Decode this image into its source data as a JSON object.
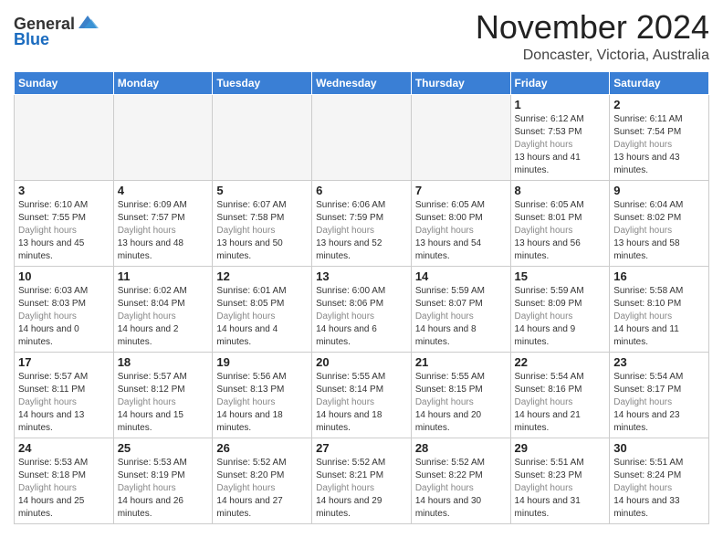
{
  "header": {
    "logo_line1": "General",
    "logo_line2": "Blue",
    "month": "November 2024",
    "location": "Doncaster, Victoria, Australia"
  },
  "weekdays": [
    "Sunday",
    "Monday",
    "Tuesday",
    "Wednesday",
    "Thursday",
    "Friday",
    "Saturday"
  ],
  "weeks": [
    [
      {
        "day": "",
        "sunrise": "",
        "sunset": "",
        "daylight": ""
      },
      {
        "day": "",
        "sunrise": "",
        "sunset": "",
        "daylight": ""
      },
      {
        "day": "",
        "sunrise": "",
        "sunset": "",
        "daylight": ""
      },
      {
        "day": "",
        "sunrise": "",
        "sunset": "",
        "daylight": ""
      },
      {
        "day": "",
        "sunrise": "",
        "sunset": "",
        "daylight": ""
      },
      {
        "day": "1",
        "sunrise": "Sunrise: 6:12 AM",
        "sunset": "Sunset: 7:53 PM",
        "daylight": "Daylight: 13 hours and 41 minutes."
      },
      {
        "day": "2",
        "sunrise": "Sunrise: 6:11 AM",
        "sunset": "Sunset: 7:54 PM",
        "daylight": "Daylight: 13 hours and 43 minutes."
      }
    ],
    [
      {
        "day": "3",
        "sunrise": "Sunrise: 6:10 AM",
        "sunset": "Sunset: 7:55 PM",
        "daylight": "Daylight: 13 hours and 45 minutes."
      },
      {
        "day": "4",
        "sunrise": "Sunrise: 6:09 AM",
        "sunset": "Sunset: 7:57 PM",
        "daylight": "Daylight: 13 hours and 48 minutes."
      },
      {
        "day": "5",
        "sunrise": "Sunrise: 6:07 AM",
        "sunset": "Sunset: 7:58 PM",
        "daylight": "Daylight: 13 hours and 50 minutes."
      },
      {
        "day": "6",
        "sunrise": "Sunrise: 6:06 AM",
        "sunset": "Sunset: 7:59 PM",
        "daylight": "Daylight: 13 hours and 52 minutes."
      },
      {
        "day": "7",
        "sunrise": "Sunrise: 6:05 AM",
        "sunset": "Sunset: 8:00 PM",
        "daylight": "Daylight: 13 hours and 54 minutes."
      },
      {
        "day": "8",
        "sunrise": "Sunrise: 6:05 AM",
        "sunset": "Sunset: 8:01 PM",
        "daylight": "Daylight: 13 hours and 56 minutes."
      },
      {
        "day": "9",
        "sunrise": "Sunrise: 6:04 AM",
        "sunset": "Sunset: 8:02 PM",
        "daylight": "Daylight: 13 hours and 58 minutes."
      }
    ],
    [
      {
        "day": "10",
        "sunrise": "Sunrise: 6:03 AM",
        "sunset": "Sunset: 8:03 PM",
        "daylight": "Daylight: 14 hours and 0 minutes."
      },
      {
        "day": "11",
        "sunrise": "Sunrise: 6:02 AM",
        "sunset": "Sunset: 8:04 PM",
        "daylight": "Daylight: 14 hours and 2 minutes."
      },
      {
        "day": "12",
        "sunrise": "Sunrise: 6:01 AM",
        "sunset": "Sunset: 8:05 PM",
        "daylight": "Daylight: 14 hours and 4 minutes."
      },
      {
        "day": "13",
        "sunrise": "Sunrise: 6:00 AM",
        "sunset": "Sunset: 8:06 PM",
        "daylight": "Daylight: 14 hours and 6 minutes."
      },
      {
        "day": "14",
        "sunrise": "Sunrise: 5:59 AM",
        "sunset": "Sunset: 8:07 PM",
        "daylight": "Daylight: 14 hours and 8 minutes."
      },
      {
        "day": "15",
        "sunrise": "Sunrise: 5:59 AM",
        "sunset": "Sunset: 8:09 PM",
        "daylight": "Daylight: 14 hours and 9 minutes."
      },
      {
        "day": "16",
        "sunrise": "Sunrise: 5:58 AM",
        "sunset": "Sunset: 8:10 PM",
        "daylight": "Daylight: 14 hours and 11 minutes."
      }
    ],
    [
      {
        "day": "17",
        "sunrise": "Sunrise: 5:57 AM",
        "sunset": "Sunset: 8:11 PM",
        "daylight": "Daylight: 14 hours and 13 minutes."
      },
      {
        "day": "18",
        "sunrise": "Sunrise: 5:57 AM",
        "sunset": "Sunset: 8:12 PM",
        "daylight": "Daylight: 14 hours and 15 minutes."
      },
      {
        "day": "19",
        "sunrise": "Sunrise: 5:56 AM",
        "sunset": "Sunset: 8:13 PM",
        "daylight": "Daylight: 14 hours and 18 minutes."
      },
      {
        "day": "20",
        "sunrise": "Sunrise: 5:55 AM",
        "sunset": "Sunset: 8:14 PM",
        "daylight": "Daylight: 14 hours and 18 minutes."
      },
      {
        "day": "21",
        "sunrise": "Sunrise: 5:55 AM",
        "sunset": "Sunset: 8:15 PM",
        "daylight": "Daylight: 14 hours and 20 minutes."
      },
      {
        "day": "22",
        "sunrise": "Sunrise: 5:54 AM",
        "sunset": "Sunset: 8:16 PM",
        "daylight": "Daylight: 14 hours and 21 minutes."
      },
      {
        "day": "23",
        "sunrise": "Sunrise: 5:54 AM",
        "sunset": "Sunset: 8:17 PM",
        "daylight": "Daylight: 14 hours and 23 minutes."
      }
    ],
    [
      {
        "day": "24",
        "sunrise": "Sunrise: 5:53 AM",
        "sunset": "Sunset: 8:18 PM",
        "daylight": "Daylight: 14 hours and 25 minutes."
      },
      {
        "day": "25",
        "sunrise": "Sunrise: 5:53 AM",
        "sunset": "Sunset: 8:19 PM",
        "daylight": "Daylight: 14 hours and 26 minutes."
      },
      {
        "day": "26",
        "sunrise": "Sunrise: 5:52 AM",
        "sunset": "Sunset: 8:20 PM",
        "daylight": "Daylight: 14 hours and 27 minutes."
      },
      {
        "day": "27",
        "sunrise": "Sunrise: 5:52 AM",
        "sunset": "Sunset: 8:21 PM",
        "daylight": "Daylight: 14 hours and 29 minutes."
      },
      {
        "day": "28",
        "sunrise": "Sunrise: 5:52 AM",
        "sunset": "Sunset: 8:22 PM",
        "daylight": "Daylight: 14 hours and 30 minutes."
      },
      {
        "day": "29",
        "sunrise": "Sunrise: 5:51 AM",
        "sunset": "Sunset: 8:23 PM",
        "daylight": "Daylight: 14 hours and 31 minutes."
      },
      {
        "day": "30",
        "sunrise": "Sunrise: 5:51 AM",
        "sunset": "Sunset: 8:24 PM",
        "daylight": "Daylight: 14 hours and 33 minutes."
      }
    ]
  ]
}
